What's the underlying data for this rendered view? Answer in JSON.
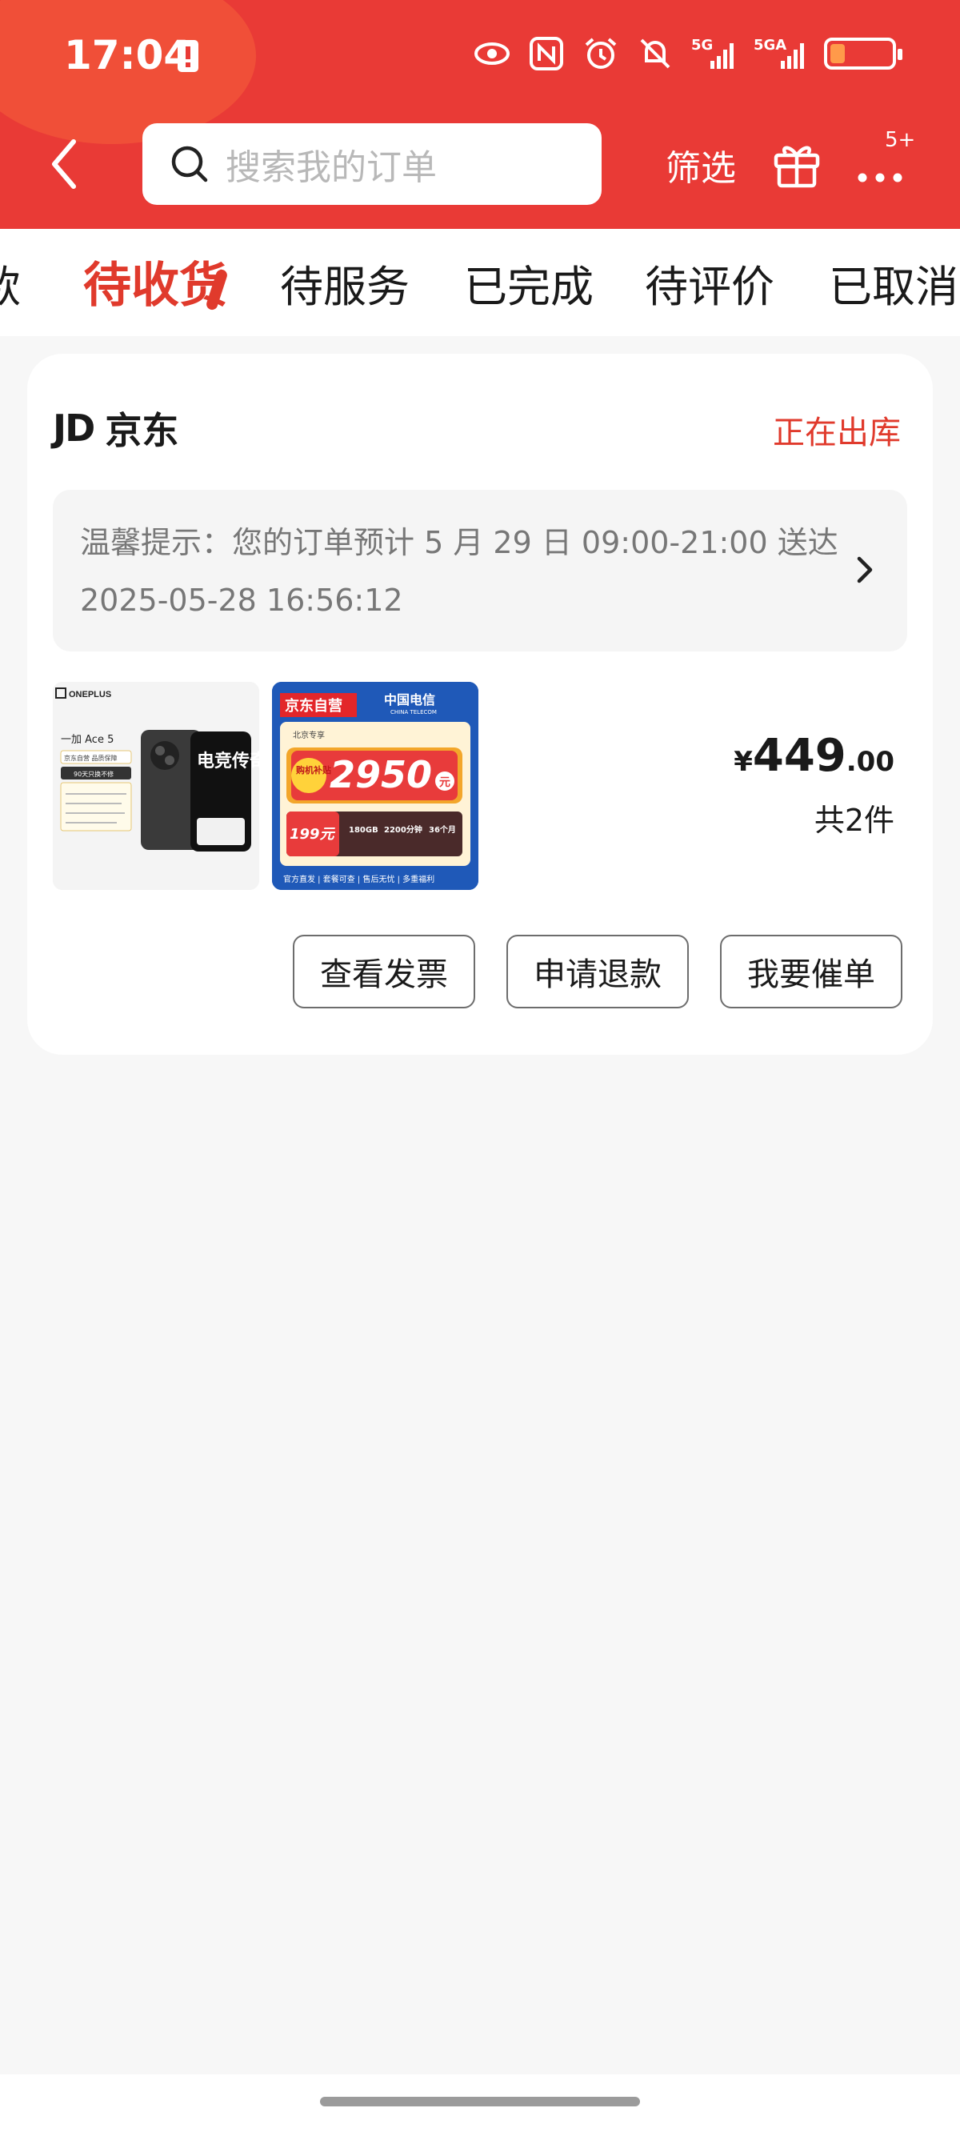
{
  "status_bar": {
    "time": "17:04",
    "icons": [
      "battery-alert-icon",
      "eye-icon",
      "nfc-icon",
      "alarm-icon",
      "mute-icon",
      "signal-5g-icon",
      "signal-5ga-icon",
      "battery-icon"
    ],
    "signal1": "5G",
    "signal2": "5GA"
  },
  "nav": {
    "search_placeholder": "搜索我的订单",
    "filter_label": "筛选",
    "more_badge": "5+"
  },
  "tabs": [
    {
      "label": "款",
      "active": false
    },
    {
      "label": "待收货",
      "active": true
    },
    {
      "label": "待服务",
      "active": false
    },
    {
      "label": "已完成",
      "active": false
    },
    {
      "label": "待评价",
      "active": false
    },
    {
      "label": "已取消",
      "active": false
    }
  ],
  "order": {
    "shop_logo": "JD",
    "shop_name": "京东",
    "status": "正在出库",
    "tip_line1": "温馨提示：您的订单预计 5 月 29 日 09:00-21:00 送达",
    "tip_line2": "2025-05-28 16:56:12",
    "products": [
      {
        "brand": "ONEPLUS",
        "model": "一加 Ace 5",
        "badge1": "京东自营 品质保障",
        "badge2": "90天只换不修",
        "hero": "电竞传奇"
      },
      {
        "brand": "京东自营",
        "carrier": "中国电信",
        "carrier_en": "CHINA TELECOM",
        "tag": "北京专享",
        "subsidy": "购机补贴",
        "amount": "2950",
        "unit": "元",
        "plan_price": "199元",
        "plan_data": "180GB",
        "plan_minutes": "2200分钟",
        "plan_months": "36个月",
        "footer": "官方直发 | 套餐可查 | 售后无忧 | 多重福利"
      }
    ],
    "price_symbol": "¥",
    "price_int": "449",
    "price_dec": ".00",
    "count": "共2件",
    "buttons": [
      "查看发票",
      "申请退款",
      "我要催单"
    ]
  },
  "colors": {
    "brand_red": "#e93a36",
    "accent_red": "#e03a2c",
    "page_bg": "#f7f7f7"
  }
}
